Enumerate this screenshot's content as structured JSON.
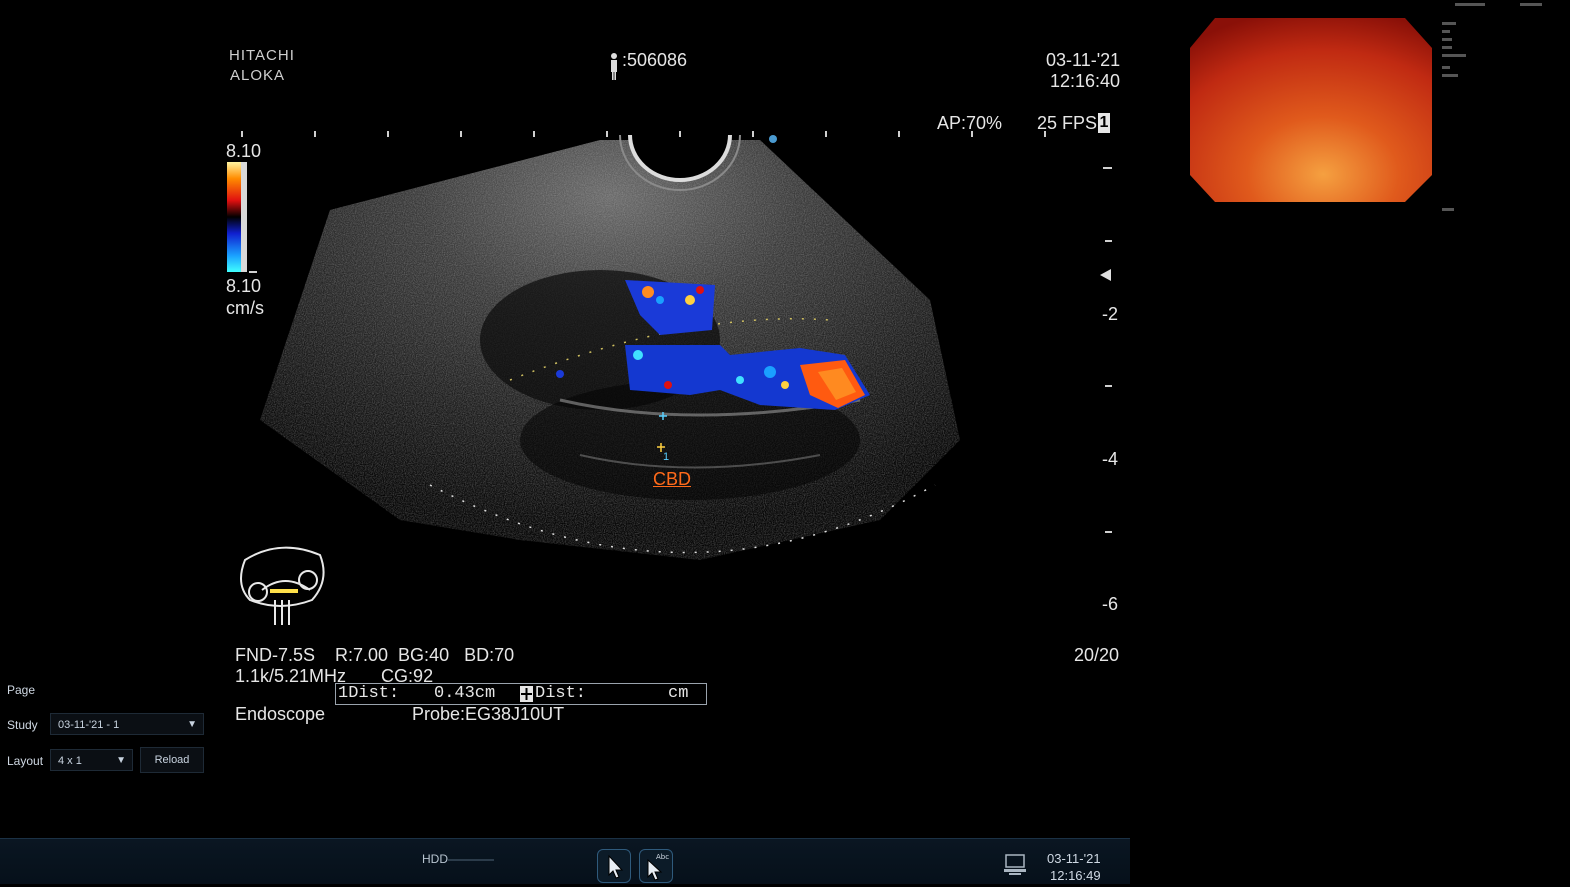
{
  "device": {
    "brand_line1": "HITACHI",
    "brand_line2": "ALOKA"
  },
  "header": {
    "patient_id": ":506086",
    "date": "03-11-'21",
    "time": "12:16:40"
  },
  "acquisition": {
    "ap": "AP:70%",
    "fps": "25 FPS",
    "fps_mark": "1"
  },
  "color_scale": {
    "top": "8.10",
    "bottom": "8.10",
    "unit": "cm/s",
    "colors": [
      "#fff4a0",
      "#ff8c00",
      "#e01010",
      "#000000",
      "#1020d0",
      "#1aa0ff",
      "#40ffff"
    ]
  },
  "depth_scale": {
    "labels": [
      "-2",
      "-4",
      "-6"
    ]
  },
  "annotation": {
    "label": "CBD",
    "marker": "1",
    "color": "#ff6a1a"
  },
  "params": {
    "line1": "FND-7.5S    R:7.00  BG:40   BD:70",
    "line2": "1.1k/5.21MHz       CG:92",
    "mode": "Endoscope",
    "probe": "Probe:EG38J10UT",
    "frame": "20/20"
  },
  "measurement": {
    "dist1_label": "1Dist:",
    "dist1_value": "0.43cm",
    "dist2_label": "Dist:",
    "dist2_unit": "cm"
  },
  "viewer": {
    "page_label": "Page",
    "study_label": "Study",
    "study_value": "03-11-'21 - 1",
    "layout_label": "Layout",
    "layout_value": "4 x 1",
    "reload_label": "Reload"
  },
  "statusbar": {
    "hdd": "HDD",
    "date": "03-11-'21",
    "time": "12:16:49",
    "pointer_tool_icon": "cursor-arrow-icon",
    "annotate_tool_icon": "cursor-text-icon",
    "system_icon": "computer-icon"
  },
  "endoscope_view": {
    "colors": [
      "#f07020",
      "#d0301a",
      "#a01008"
    ]
  }
}
